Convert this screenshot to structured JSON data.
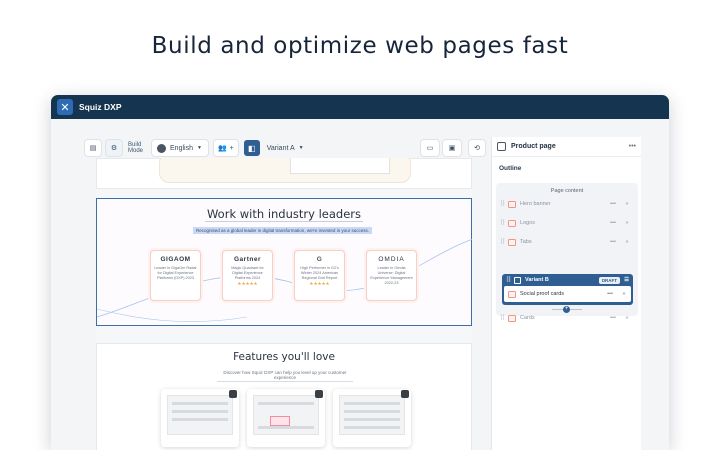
{
  "headline": "Build and optimize web pages fast",
  "app": {
    "name": "Squiz DXP"
  },
  "toolbar": {
    "mode_label_1": "Build",
    "mode_label_2": "Mode",
    "language": "English",
    "variant": "Variant A",
    "icons": [
      "list-icon",
      "settings-icon",
      "users-icon",
      "plus-icon",
      "variant-icon",
      "device-icon",
      "image-icon",
      "history-icon"
    ]
  },
  "canvas": {
    "industry": {
      "title": "Work with industry leaders",
      "subtitle": "Recognised as a global leader in digital transformation, we're invested in your success.",
      "awards": [
        {
          "brand": "GIGAOM",
          "desc": "Leader in GigaOm Radar for Digital Experience Platforms (DXP) 2023",
          "stars": ""
        },
        {
          "brand": "Gartner",
          "desc": "Magic Quadrant for Digital Experience Platforms 2024",
          "stars": "★★★★★"
        },
        {
          "brand": "G",
          "desc": "High Performer in G2's Winter 2024 Americas Regional Grid Report",
          "stars": "★★★★★"
        },
        {
          "brand": "OMDIA",
          "desc": "Leader in Omdia Universe: Digital Experience Management 2022-23",
          "stars": ""
        }
      ]
    },
    "features": {
      "title": "Features you'll love",
      "subtitle": "Discover how Squiz DXP can help you level up your customer experience"
    }
  },
  "panel": {
    "title": "Product page",
    "outline": "Outline",
    "page_content": "Page content",
    "items": [
      {
        "label": "Hero banner"
      },
      {
        "label": "Logos"
      },
      {
        "label": "Tabs"
      }
    ],
    "variant": {
      "label": "Variant B",
      "badge": "DRAFT",
      "child": "Social proof cards"
    },
    "after": {
      "label": "Cards"
    }
  }
}
